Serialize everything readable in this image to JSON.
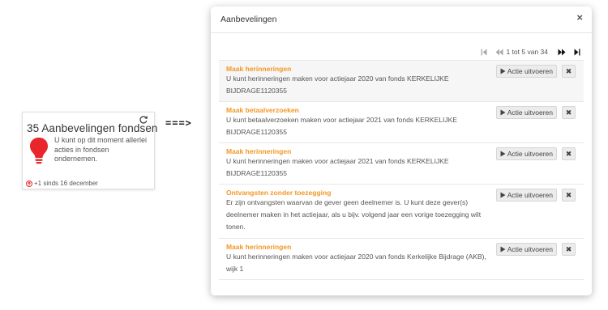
{
  "widget": {
    "title": "35 Aanbevelingen fondsen",
    "message": "U kunt op dit moment allerlei acties in fondsen ondernemen.",
    "footer": "+1 sinds 16 december",
    "icons": {
      "refresh": "refresh-icon",
      "bulb": "lightbulb-icon",
      "trend": "arrow-up-circle-icon"
    },
    "colors": {
      "bulb": "#e8262b",
      "trend": "#e8262b"
    }
  },
  "arrow": "===>",
  "modal": {
    "title": "Aanbevelingen",
    "close": "×",
    "pager": {
      "text": "1 tot 5 van 34",
      "icons": [
        "first-page-icon",
        "previous-page-icon",
        "next-page-icon",
        "last-page-icon"
      ]
    },
    "recommendations": [
      {
        "title": "Maak herinneringen",
        "text": "U kunt herinneringen maken voor actiejaar 2020 van fonds KERKELIJKE BIJDRAGE1120355",
        "action": "Actie uitvoeren",
        "dismiss": "✖"
      },
      {
        "title": "Maak betaalverzoeken",
        "text": "U kunt betaalverzoeken maken voor actiejaar 2021 van fonds KERKELIJKE BIJDRAGE1120355",
        "action": "Actie uitvoeren",
        "dismiss": "✖"
      },
      {
        "title": "Maak herinneringen",
        "text": "U kunt herinneringen maken voor actiejaar 2021 van fonds KERKELIJKE BIJDRAGE1120355",
        "action": "Actie uitvoeren",
        "dismiss": "✖"
      },
      {
        "title": "Ontvangsten zonder toezegging",
        "text": "Er zijn ontvangsten waarvan de gever geen deelnemer is. U kunt deze gever(s) deelnemer maken in het actiejaar, als u bijv. volgend jaar een vorige toezegging wilt tonen.",
        "action": "Actie uitvoeren",
        "dismiss": "✖"
      },
      {
        "title": "Maak herinneringen",
        "text": "U kunt herinneringen maken voor actiejaar 2020 van fonds Kerkelijke Bijdrage (AKB), wijk 1",
        "action": "Actie uitvoeren",
        "dismiss": "✖"
      }
    ],
    "colors": {
      "title_accent": "#f29727"
    }
  }
}
